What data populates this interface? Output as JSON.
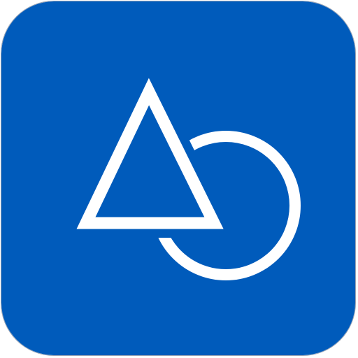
{
  "app_icon": {
    "icon_name": "triangle-circle-shapes-icon",
    "colors": {
      "tile": "#005bbb",
      "glyph": "#ffffff",
      "outline": "#9aa4b4",
      "page": "#ffffff"
    }
  }
}
